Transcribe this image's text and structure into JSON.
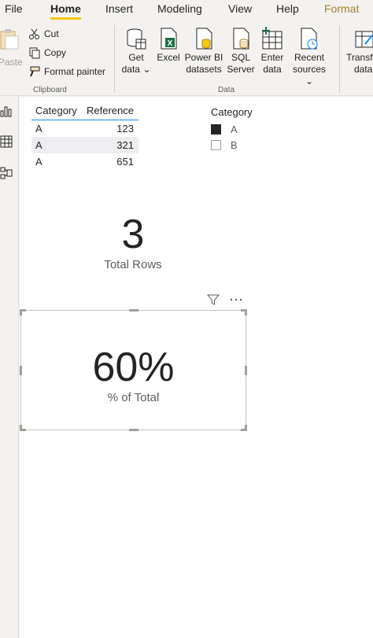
{
  "menu": [
    "File",
    "Home",
    "Insert",
    "Modeling",
    "View",
    "Help",
    "Format"
  ],
  "clipboard": {
    "paste": "Paste",
    "cut": "Cut",
    "copy": "Copy",
    "format_painter": "Format painter",
    "group": "Clipboard"
  },
  "data_group": {
    "get_data": [
      "Get",
      "data ⌄"
    ],
    "excel": "Excel",
    "powerbi": [
      "Power BI",
      "datasets"
    ],
    "sql": [
      "SQL",
      "Server"
    ],
    "enter": [
      "Enter",
      "data"
    ],
    "recent": [
      "Recent",
      "sources ⌄"
    ],
    "transform": [
      "Transfo",
      "data"
    ],
    "group": "Data"
  },
  "table": {
    "headers": [
      "Category",
      "Reference"
    ],
    "rows": [
      [
        "A",
        "123"
      ],
      [
        "A",
        "321"
      ],
      [
        "A",
        "651"
      ]
    ]
  },
  "slicer": {
    "title": "Category",
    "options": [
      {
        "label": "A",
        "checked": true
      },
      {
        "label": "B",
        "checked": false
      }
    ]
  },
  "card1": {
    "value": "3",
    "label": "Total Rows"
  },
  "card2": {
    "value": "60%",
    "label": "% of Total"
  }
}
